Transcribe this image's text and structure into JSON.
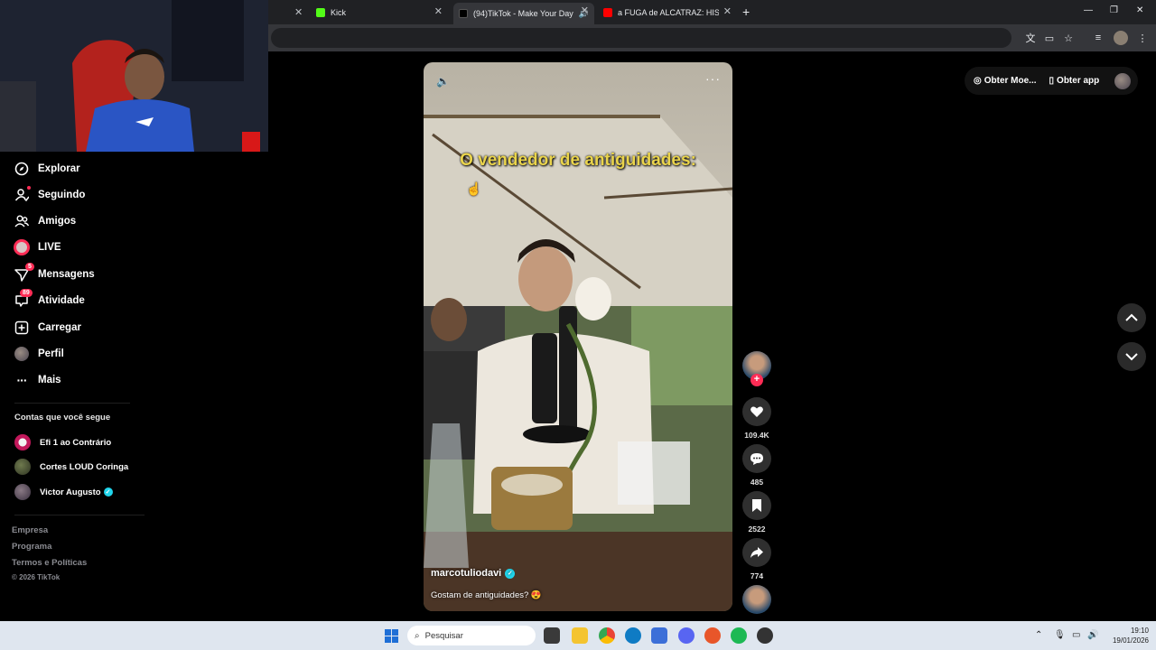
{
  "browser": {
    "tabs": [
      {
        "label": "Kick",
        "favicon_color": "#53fc18",
        "favicon": "kick-icon"
      },
      {
        "label": "(94)TikTok - Make Your Day",
        "favicon_color": "#000000",
        "favicon": "tiktok-icon",
        "active": true
      },
      {
        "label": "a FUGA de ALCATRAZ: HISTÓRI",
        "favicon_color": "#ff0000",
        "favicon": "youtube-icon"
      }
    ],
    "new_tab": "+"
  },
  "sidebar": {
    "items": [
      {
        "label": "Explorar",
        "icon": "compass-icon"
      },
      {
        "label": "Seguindo",
        "icon": "following-icon"
      },
      {
        "label": "Amigos",
        "icon": "friends-icon"
      },
      {
        "label": "LIVE",
        "icon": "live-icon"
      },
      {
        "label": "Mensagens",
        "icon": "messages-icon",
        "badge": "5"
      },
      {
        "label": "Atividade",
        "icon": "activity-icon",
        "badge": "89"
      },
      {
        "label": "Carregar",
        "icon": "upload-icon"
      },
      {
        "label": "Perfil",
        "icon": "profile-avatar"
      },
      {
        "label": "Mais",
        "icon": "more-icon"
      }
    ],
    "following_title": "Contas que você segue",
    "following": [
      {
        "name": "Efi 1 ao Contrário"
      },
      {
        "name": "Cortes LOUD Coringa"
      },
      {
        "name": "Victor Augusto",
        "verified": true
      }
    ],
    "footer": [
      "Empresa",
      "Programa",
      "Termos e Políticas"
    ],
    "copyright": "© 2026 TikTok"
  },
  "video": {
    "caption_overlay": "O vendedor de antiguidades:",
    "author": "marcotuliodavi",
    "description": "Gostam de antiguidades? 😍"
  },
  "actions": {
    "likes": "109.4K",
    "comments": "485",
    "saves": "2522",
    "shares": "774"
  },
  "topright": {
    "coins_label": "Obter Moe...",
    "app_label": "Obter app"
  },
  "taskbar": {
    "search_placeholder": "Pesquisar",
    "time": "19:10",
    "date": "19/01/2026"
  },
  "colors": {
    "accent": "#fe2c55",
    "verified": "#20d5ec",
    "taskbar": "#dfe6ef"
  }
}
